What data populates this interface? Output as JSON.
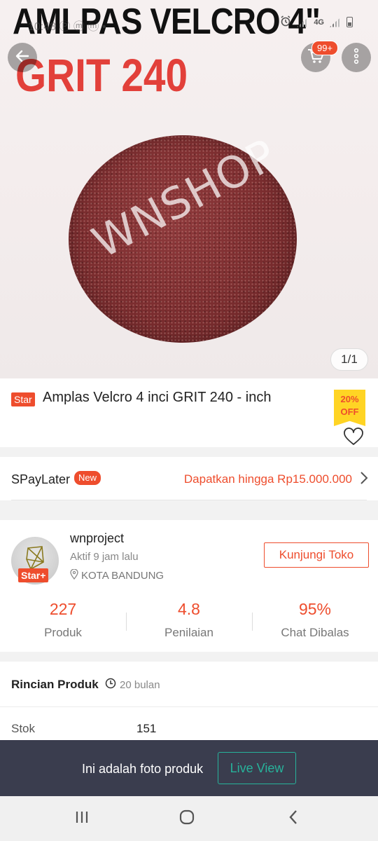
{
  "status_bar": {
    "time": "10:48 Ⓟ ⓜ ⓜ •",
    "network": "4G"
  },
  "hero": {
    "headline": "AMLPAS VELCRO 4\"",
    "subline": "GRIT 240",
    "watermark": "WNSHOP",
    "image_counter": "1/1"
  },
  "header": {
    "cart_badge": "99+",
    "icons": [
      "back-arrow-icon",
      "cart-icon",
      "more-vertical-icon"
    ]
  },
  "product": {
    "badge": "Star",
    "name": "Amplas Velcro 4 inci GRIT 240 - inch",
    "discount_line1": "20%",
    "discount_line2": "OFF"
  },
  "spaylater": {
    "label": "SPayLater",
    "tag": "New",
    "promo": "Dapatkan hingga Rp15.000.000"
  },
  "shop": {
    "name": "wnproject",
    "badge": "Star+",
    "active": "Aktif 9 jam lalu",
    "location": "KOTA BANDUNG",
    "visit_label": "Kunjungi Toko",
    "stats": [
      {
        "value": "227",
        "label": "Produk"
      },
      {
        "value": "4.8",
        "label": "Penilaian"
      },
      {
        "value": "95%",
        "label": "Chat Dibalas"
      }
    ]
  },
  "details": {
    "title": "Rincian Produk",
    "age": "20 bulan",
    "stock_label": "Stok",
    "stock_value": "151"
  },
  "banner": {
    "text": "Ini adalah foto produk",
    "button": "Live View"
  },
  "colors": {
    "accent": "#ee4d2d",
    "banner_bg": "#3a3d4e",
    "live_green": "#27b39b",
    "discount_yellow": "#ffd424"
  }
}
